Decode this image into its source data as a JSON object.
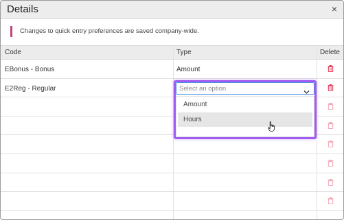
{
  "dialog": {
    "title": "Details",
    "close_label": "×",
    "notice": "Changes to quick entry preferences are saved company-wide."
  },
  "table": {
    "headers": {
      "code": "Code",
      "type": "Type",
      "delete": "Delete"
    },
    "rows": [
      {
        "code": "EBonus - Bonus",
        "type": "Amount"
      },
      {
        "code": "E2Reg - Regular",
        "type": ""
      }
    ]
  },
  "select": {
    "placeholder": "Select an option",
    "options": [
      "Amount",
      "Hours"
    ],
    "hovered": "Hours"
  },
  "colors": {
    "accent": "#a05cf2",
    "notice_bar": "#c2417a",
    "delete_active": "#e0314f",
    "delete_disabled": "#f0a0ad"
  }
}
